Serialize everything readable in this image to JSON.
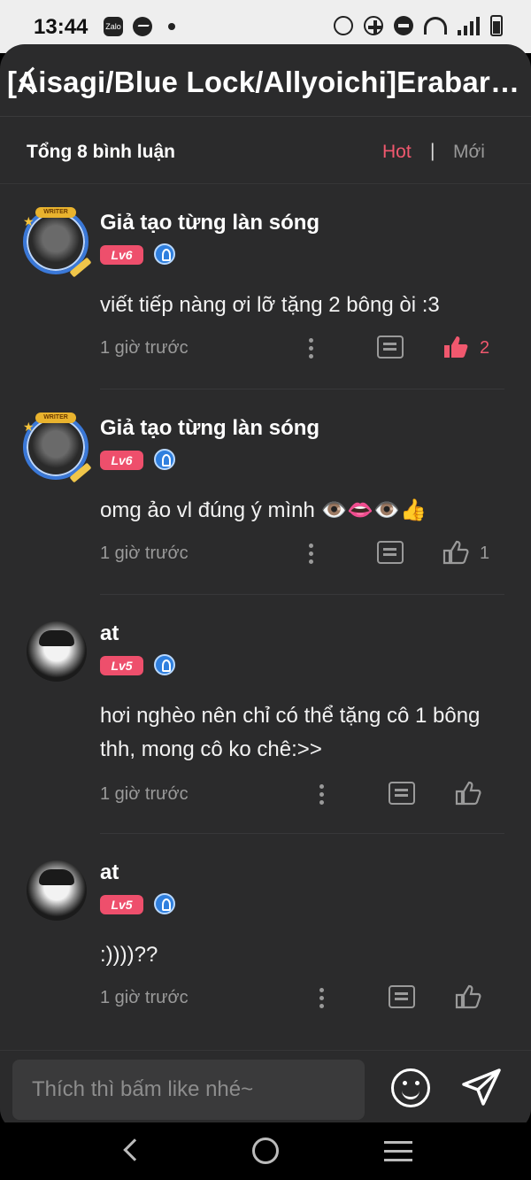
{
  "status": {
    "time": "13:44",
    "zalo_label": "Zalo"
  },
  "header": {
    "title": "[Aisagi/Blue Lock/Allyoichi]Erabaresh…"
  },
  "sort": {
    "total": "Tổng 8 bình luận",
    "hot": "Hot",
    "separator": "|",
    "new": "Mới"
  },
  "comments": [
    {
      "user": "Giả tạo từng làn sóng",
      "level": "Lv6",
      "text": "viết tiếp nàng ơi lỡ tặng 2 bông òi :3",
      "time": "1 giờ trước",
      "likes": "2",
      "liked": true,
      "avatar": "writer-avatar"
    },
    {
      "user": "Giả tạo từng làn sóng",
      "level": "Lv6",
      "text": "omg ảo vl đúng ý mình 👁️👄👁️👍",
      "time": "1 giờ trước",
      "likes": "1",
      "liked": false,
      "avatar": "writer-avatar"
    },
    {
      "user": "at",
      "level": "Lv5",
      "text": "hơi nghèo nên chỉ có thể tặng cô 1 bông thh, mong cô ko chê:>>",
      "time": "1 giờ trước",
      "likes": "",
      "liked": false,
      "avatar": "anime-avatar"
    },
    {
      "user": "at",
      "level": "Lv5",
      "text": ":))))??",
      "time": "1 giờ trước",
      "likes": "",
      "liked": false,
      "avatar": "anime-avatar"
    }
  ],
  "composer": {
    "placeholder": "Thích thì bấm like nhé~"
  },
  "colors": {
    "accent": "#f0586e",
    "background": "#2b2b2c",
    "level_badge": "#ee4f6c"
  }
}
